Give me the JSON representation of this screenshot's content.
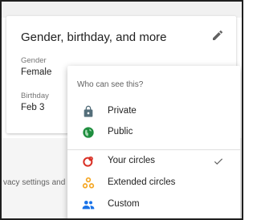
{
  "section": {
    "title": "Gender, birthday, and more",
    "fields": [
      {
        "label": "Gender",
        "value": "Female"
      },
      {
        "label": "Birthday",
        "value": "Feb 3"
      }
    ]
  },
  "background_text": "vacy settings and",
  "visibility_menu": {
    "header": "Who can see this?",
    "items": [
      {
        "label": "Private",
        "icon": "lock-icon"
      },
      {
        "label": "Public",
        "icon": "globe-icon"
      },
      {
        "label": "Your circles",
        "icon": "circles-icon",
        "selected": true
      },
      {
        "label": "Extended circles",
        "icon": "extended-circles-icon"
      },
      {
        "label": "Custom",
        "icon": "people-icon"
      }
    ]
  },
  "colors": {
    "lock": "#546e7a",
    "globe": "#1e8e3e",
    "circles": "#d93025",
    "extended": "#f5a623",
    "people": "#1a73e8"
  }
}
